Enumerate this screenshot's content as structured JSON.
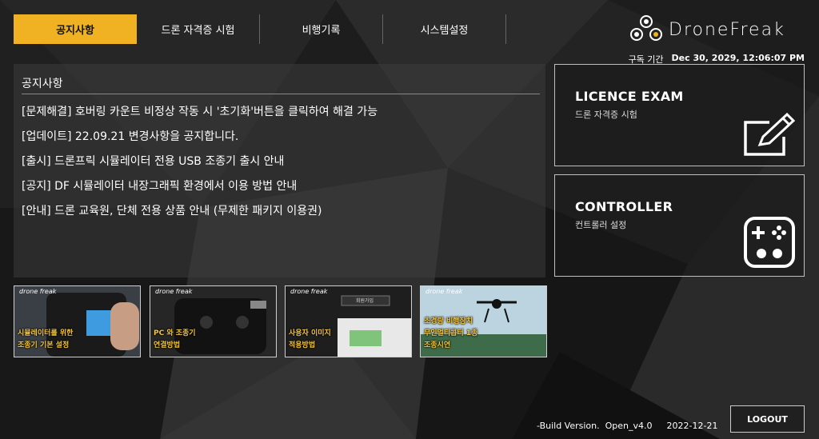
{
  "tabs": [
    {
      "label": "공지사항",
      "active": true
    },
    {
      "label": "드론 자격증 시험",
      "active": false
    },
    {
      "label": "비행기록",
      "active": false
    },
    {
      "label": "시스템설정",
      "active": false
    }
  ],
  "brand": {
    "logo_text": "DroneFreak"
  },
  "subscription": {
    "label": "구독 기간",
    "value": "Dec 30, 2029, 12:06:07 PM"
  },
  "notice": {
    "title": "공지사항",
    "items": [
      "[문제해결] 호버링 카운트 비정상 작동 시 '초기화'버튼을 클릭하여 해결 가능",
      "[업데이트] 22.09.21 변경사항을 공지합니다.",
      "[출시] 드론프릭 시뮬레이터 전용 USB 조종기 출시 안내",
      "[공지] DF 시뮬레이터 내장그래픽 환경에서 이용 방법 안내",
      "[안내] 드론 교육원, 단체 전용 상품 안내 (무제한 패키지 이용권)"
    ]
  },
  "cards": [
    {
      "title": "LICENCE EXAM",
      "subtitle": "드론 자격증 시험",
      "icon": "pencil-edit-icon"
    },
    {
      "title": "CONTROLLER",
      "subtitle": "컨트롤러 설정",
      "icon": "gamepad-icon"
    }
  ],
  "videos": [
    {
      "logo": "drone freak",
      "line1": "시뮬레이터를 위한",
      "line2": "조종기 기본 설정"
    },
    {
      "logo": "drone freak",
      "line1": "PC 와 조종기",
      "line2": "연결방법"
    },
    {
      "logo": "drone freak",
      "line1": "사용자 이미지",
      "line2": "적용방법",
      "extra": "회원가입"
    },
    {
      "logo": "drone freak",
      "line1": "초경량 비행장치",
      "line2": "무인멀티콥터 1종",
      "line3": "조종시연"
    }
  ],
  "footer": {
    "build_label": "-Build Version.",
    "build_version": "Open_v4.0",
    "build_date": "2022-12-21",
    "logout": "LOGOUT"
  },
  "colors": {
    "accent": "#f0b222",
    "background": "#1c1c1c"
  }
}
